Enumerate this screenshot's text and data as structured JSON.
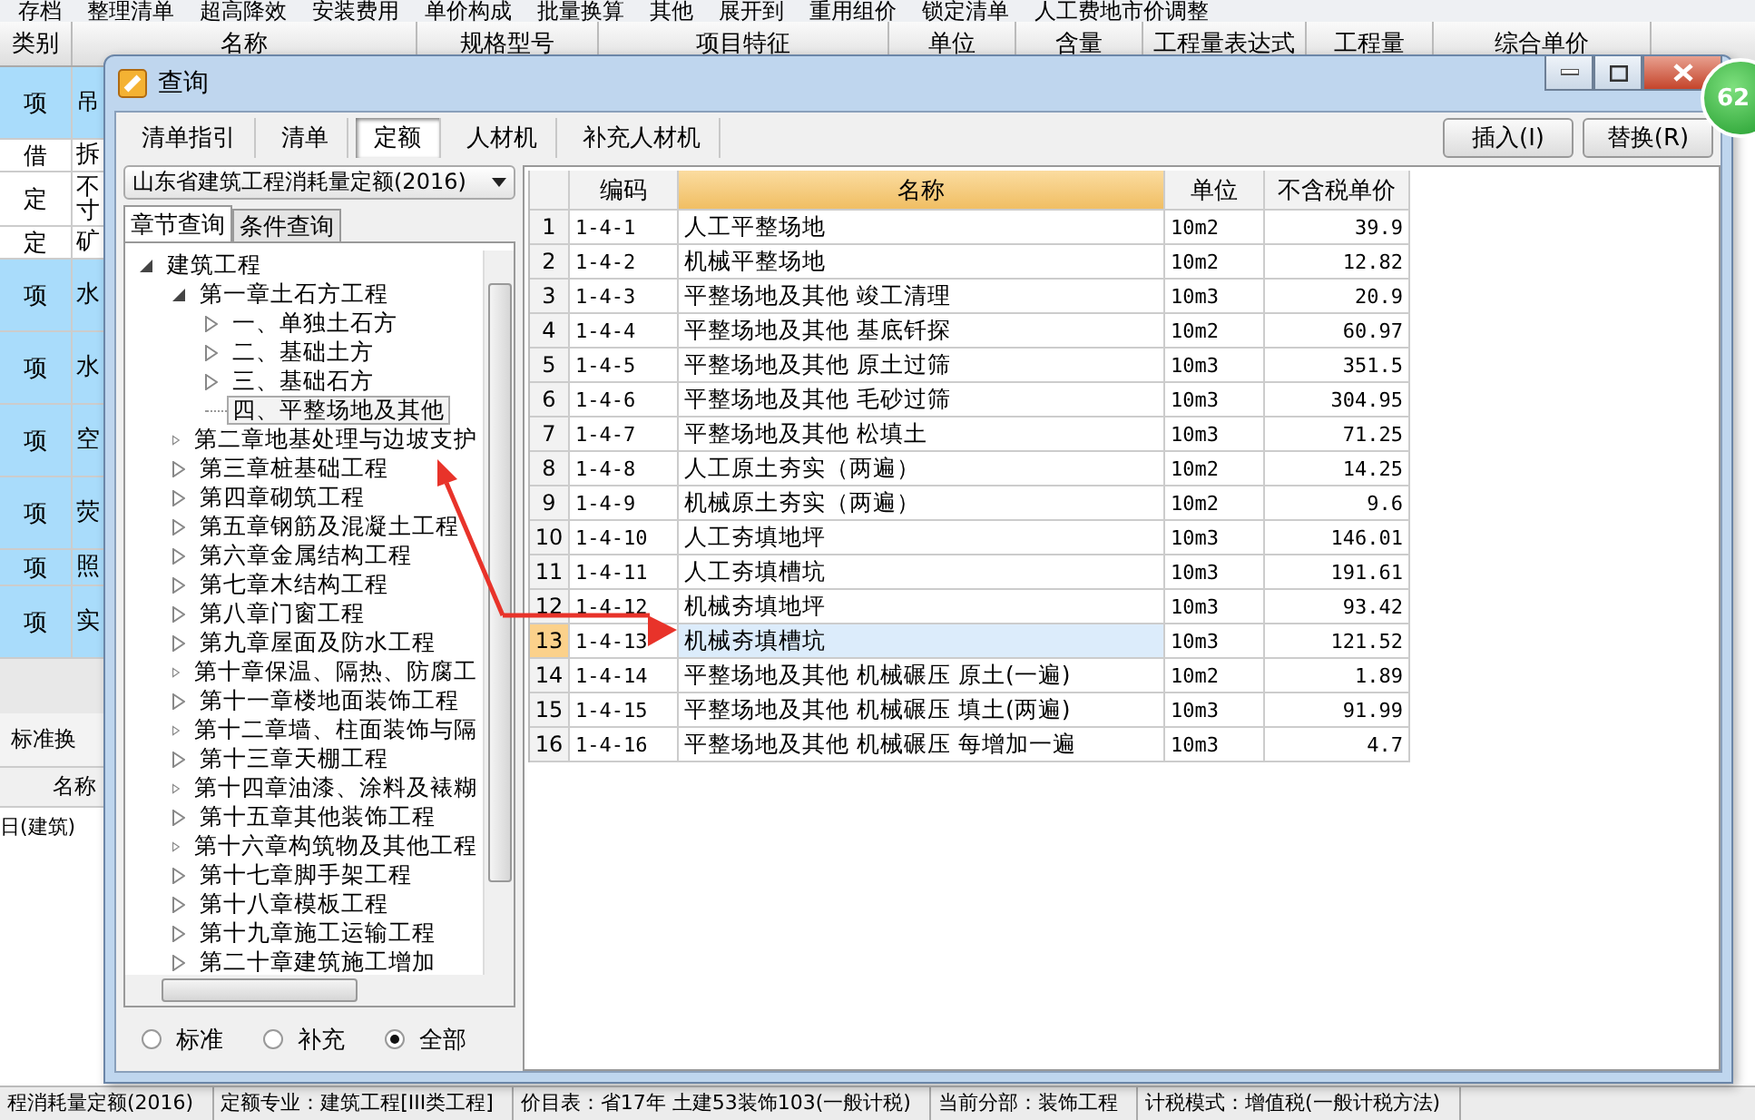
{
  "app": {
    "toolbar": [
      "存档",
      "整理清单",
      "超高降效",
      "安装费用",
      "单价构成",
      "批量换算",
      "其他",
      "展开到",
      "重用组价",
      "锁定清单",
      "人工费地市价调整"
    ],
    "columns": [
      "类别",
      "名称",
      "规格型号",
      "项目特征",
      "单位",
      "含量",
      "工程量表达式",
      "工程量",
      "综合单价"
    ],
    "rows": [
      {
        "kind": "item",
        "type": "项",
        "name": "吊"
      },
      {
        "kind": "line",
        "type": "借",
        "name": "拆"
      },
      {
        "kind": "double",
        "type": "定",
        "name": "不寸"
      },
      {
        "kind": "line",
        "type": "定",
        "name": "矿"
      },
      {
        "kind": "item",
        "type": "项",
        "name": "水"
      },
      {
        "kind": "item",
        "type": "项",
        "name": "水"
      },
      {
        "kind": "item",
        "type": "项",
        "name": "空"
      },
      {
        "kind": "item",
        "type": "项",
        "name": "荧"
      },
      {
        "kind": "short",
        "type": "项",
        "name": "照"
      },
      {
        "kind": "item",
        "type": "项",
        "name": "实"
      }
    ],
    "lower_tab": "标准换",
    "lower_column": "名称",
    "lower_row": "日(建筑)",
    "status_bar": [
      "程消耗量定额(2016)",
      "定额专业：建筑工程[III类工程]",
      "价目表：省17年 土建53装饰103(一般计税)",
      "当前分部：装饰工程",
      "计税模式：增值税(一般计税方法)"
    ]
  },
  "dialog": {
    "title": "查询",
    "tabs": [
      {
        "label": "清单指引",
        "selected": false
      },
      {
        "label": "清单",
        "selected": false
      },
      {
        "label": "定额",
        "selected": true
      },
      {
        "label": "人材机",
        "selected": false
      },
      {
        "label": "补充人材机",
        "selected": false
      }
    ],
    "buttons": [
      "插入(I)",
      "替换(R)"
    ],
    "library": "山东省建筑工程消耗量定额(2016)",
    "subtabs": [
      {
        "label": "章节查询",
        "selected": true
      },
      {
        "label": "条件查询",
        "selected": false
      }
    ],
    "tree": [
      {
        "label": "建筑工程",
        "expanded": true,
        "selected": false,
        "children": [
          {
            "label": "第一章土石方工程",
            "expanded": true,
            "selected": false,
            "children": [
              {
                "label": "一、单独土石方",
                "expanded": false,
                "selected": false
              },
              {
                "label": "二、基础土方",
                "expanded": false,
                "selected": false
              },
              {
                "label": "三、基础石方",
                "expanded": false,
                "selected": false
              },
              {
                "label": "四、平整场地及其他",
                "selected": true
              }
            ]
          },
          {
            "label": "第二章地基处理与边坡支护",
            "expanded": false,
            "selected": false
          },
          {
            "label": "第三章桩基础工程",
            "expanded": false,
            "selected": false
          },
          {
            "label": "第四章砌筑工程",
            "expanded": false,
            "selected": false
          },
          {
            "label": "第五章钢筋及混凝土工程",
            "expanded": false,
            "selected": false
          },
          {
            "label": "第六章金属结构工程",
            "expanded": false,
            "selected": false
          },
          {
            "label": "第七章木结构工程",
            "expanded": false,
            "selected": false
          },
          {
            "label": "第八章门窗工程",
            "expanded": false,
            "selected": false
          },
          {
            "label": "第九章屋面及防水工程",
            "expanded": false,
            "selected": false
          },
          {
            "label": "第十章保温、隔热、防腐工",
            "expanded": false,
            "selected": false
          },
          {
            "label": "第十一章楼地面装饰工程",
            "expanded": false,
            "selected": false
          },
          {
            "label": "第十二章墙、柱面装饰与隔",
            "expanded": false,
            "selected": false
          },
          {
            "label": "第十三章天棚工程",
            "expanded": false,
            "selected": false
          },
          {
            "label": "第十四章油漆、涂料及裱糊",
            "expanded": false,
            "selected": false
          },
          {
            "label": "第十五章其他装饰工程",
            "expanded": false,
            "selected": false
          },
          {
            "label": "第十六章构筑物及其他工程",
            "expanded": false,
            "selected": false
          },
          {
            "label": "第十七章脚手架工程",
            "expanded": false,
            "selected": false
          },
          {
            "label": "第十八章模板工程",
            "expanded": false,
            "selected": false
          },
          {
            "label": "第十九章施工运输工程",
            "expanded": false,
            "selected": false
          },
          {
            "label": "第二十章建筑施工增加",
            "expanded": false,
            "selected": false
          }
        ]
      }
    ],
    "filters": [
      {
        "label": "标准",
        "selected": false
      },
      {
        "label": "补充",
        "selected": false
      },
      {
        "label": "全部",
        "selected": true
      }
    ],
    "table": {
      "columns": [
        {
          "label": "编码",
          "selected": false
        },
        {
          "label": "名称",
          "selected": true
        },
        {
          "label": "单位",
          "selected": false
        },
        {
          "label": "不含税单价",
          "selected": false
        }
      ],
      "rows": [
        {
          "no": "1",
          "code": "1-4-1",
          "name": "人工平整场地",
          "unit": "10m2",
          "price": "39.9",
          "selected": false
        },
        {
          "no": "2",
          "code": "1-4-2",
          "name": "机械平整场地",
          "unit": "10m2",
          "price": "12.82",
          "selected": false
        },
        {
          "no": "3",
          "code": "1-4-3",
          "name": "平整场地及其他 竣工清理",
          "unit": "10m3",
          "price": "20.9",
          "selected": false
        },
        {
          "no": "4",
          "code": "1-4-4",
          "name": "平整场地及其他 基底钎探",
          "unit": "10m2",
          "price": "60.97",
          "selected": false
        },
        {
          "no": "5",
          "code": "1-4-5",
          "name": "平整场地及其他 原土过筛",
          "unit": "10m3",
          "price": "351.5",
          "selected": false
        },
        {
          "no": "6",
          "code": "1-4-6",
          "name": "平整场地及其他 毛砂过筛",
          "unit": "10m3",
          "price": "304.95",
          "selected": false
        },
        {
          "no": "7",
          "code": "1-4-7",
          "name": "平整场地及其他 松填土",
          "unit": "10m3",
          "price": "71.25",
          "selected": false
        },
        {
          "no": "8",
          "code": "1-4-8",
          "name": "人工原土夯实（两遍）",
          "unit": "10m2",
          "price": "14.25",
          "selected": false
        },
        {
          "no": "9",
          "code": "1-4-9",
          "name": "机械原土夯实（两遍）",
          "unit": "10m2",
          "price": "9.6",
          "selected": false
        },
        {
          "no": "10",
          "code": "1-4-10",
          "name": "人工夯填地坪",
          "unit": "10m3",
          "price": "146.01",
          "selected": false
        },
        {
          "no": "11",
          "code": "1-4-11",
          "name": "人工夯填槽坑",
          "unit": "10m3",
          "price": "191.61",
          "selected": false
        },
        {
          "no": "12",
          "code": "1-4-12",
          "name": "机械夯填地坪",
          "unit": "10m3",
          "price": "93.42",
          "selected": false
        },
        {
          "no": "13",
          "code": "1-4-13",
          "name": "机械夯填槽坑",
          "unit": "10m3",
          "price": "121.52",
          "selected": true
        },
        {
          "no": "14",
          "code": "1-4-14",
          "name": "平整场地及其他 机械碾压 原土(一遍)",
          "unit": "10m2",
          "price": "1.89",
          "selected": false
        },
        {
          "no": "15",
          "code": "1-4-15",
          "name": "平整场地及其他 机械碾压 填土(两遍)",
          "unit": "10m3",
          "price": "91.99",
          "selected": false
        },
        {
          "no": "16",
          "code": "1-4-16",
          "name": "平整场地及其他 机械碾压 每增加一遍",
          "unit": "10m3",
          "price": "4.7",
          "selected": false
        }
      ]
    }
  },
  "badge": "62"
}
